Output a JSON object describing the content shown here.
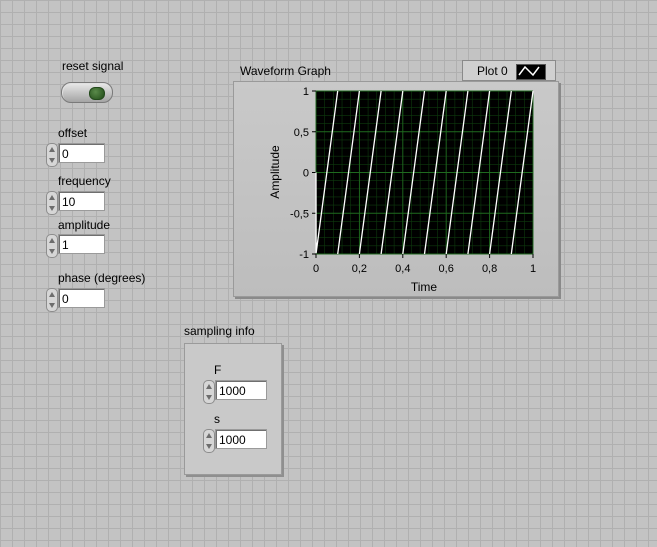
{
  "controls": {
    "reset_signal": {
      "label": "reset signal"
    },
    "offset": {
      "label": "offset",
      "value": "0"
    },
    "frequency": {
      "label": "frequency",
      "value": "10"
    },
    "amplitude": {
      "label": "amplitude",
      "value": "1"
    },
    "phase": {
      "label": "phase (degrees)",
      "value": "0"
    }
  },
  "graph": {
    "title": "Waveform Graph",
    "legend": {
      "plot_name": "Plot 0"
    }
  },
  "chart_data": {
    "type": "line",
    "title": "Waveform Graph",
    "xlabel": "Time",
    "ylabel": "Amplitude",
    "xlim": [
      0,
      1
    ],
    "ylim": [
      -1,
      1
    ],
    "xticks": [
      "0",
      "0,2",
      "0,4",
      "0,6",
      "0,8",
      "1"
    ],
    "yticks": [
      "1",
      "0,5",
      "0",
      "-0,5",
      "-1"
    ],
    "grid": true,
    "series": [
      {
        "name": "Plot 0",
        "color": "#ffffff",
        "waveform": "sawtooth",
        "frequency": 10,
        "amplitude": 1,
        "offset": 0,
        "phase_deg": 0
      }
    ]
  },
  "sampling_info": {
    "label": "sampling info",
    "F": {
      "label": "F",
      "value": "1000"
    },
    "s": {
      "label": "s",
      "value": "1000"
    }
  }
}
